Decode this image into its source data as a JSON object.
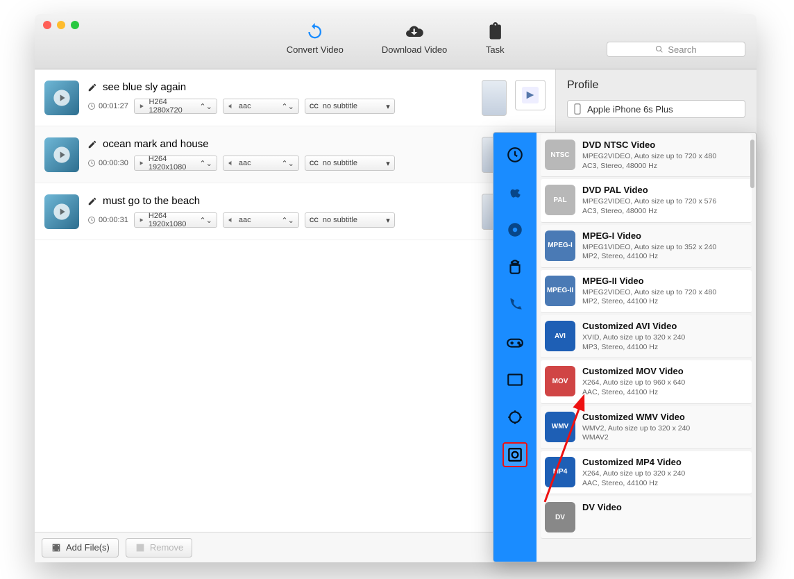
{
  "toolbar": {
    "convert": "Convert Video",
    "download": "Download Video",
    "task": "Task"
  },
  "search": {
    "placeholder": "Search"
  },
  "files": [
    {
      "title": "see blue sly again",
      "duration": "00:01:27",
      "format": "H264 1280x720",
      "audio": "aac",
      "subtitle": "no subtitle"
    },
    {
      "title": "ocean mark and house",
      "duration": "00:00:30",
      "format": "H264 1920x1080",
      "audio": "aac",
      "subtitle": "no subtitle"
    },
    {
      "title": "must go to the beach",
      "duration": "00:00:31",
      "format": "H264 1920x1080",
      "audio": "aac",
      "subtitle": "no subtitle"
    }
  ],
  "footer": {
    "add": "Add File(s)",
    "remove": "Remove"
  },
  "profile": {
    "heading": "Profile",
    "selected": "Apple iPhone 6s Plus"
  },
  "subtitle_prefix": "CC",
  "categories": [
    "recent",
    "apple",
    "disc",
    "android",
    "phone",
    "game",
    "video",
    "custom",
    "format"
  ],
  "profiles": [
    {
      "name": "DVD NTSC Video",
      "desc1": "MPEG2VIDEO, Auto size up to 720 x 480",
      "desc2": "AC3, Stereo, 48000 Hz",
      "badge": "NTSC",
      "bg": "#b8b8b8"
    },
    {
      "name": "DVD PAL Video",
      "desc1": "MPEG2VIDEO, Auto size up to 720 x 576",
      "desc2": "AC3, Stereo, 48000 Hz",
      "badge": "PAL",
      "bg": "#b8b8b8"
    },
    {
      "name": "MPEG-I Video",
      "desc1": "MPEG1VIDEO, Auto size up to 352 x 240",
      "desc2": "MP2, Stereo, 44100 Hz",
      "badge": "MPEG-I",
      "bg": "#4a7ab5"
    },
    {
      "name": "MPEG-II Video",
      "desc1": "MPEG2VIDEO, Auto size up to 720 x 480",
      "desc2": "MP2, Stereo, 44100 Hz",
      "badge": "MPEG-II",
      "bg": "#4a7ab5"
    },
    {
      "name": "Customized AVI Video",
      "desc1": "XVID, Auto size up to 320 x 240",
      "desc2": "MP3, Stereo, 44100 Hz",
      "badge": "AVI",
      "bg": "#1e5fb5"
    },
    {
      "name": "Customized MOV Video",
      "desc1": "X264, Auto size up to 960 x 640",
      "desc2": "AAC, Stereo, 44100 Hz",
      "badge": "MOV",
      "bg": "#d04545"
    },
    {
      "name": "Customized WMV Video",
      "desc1": "WMV2, Auto size up to 320 x 240",
      "desc2": "WMAV2",
      "badge": "WMV",
      "bg": "#1e5fb5"
    },
    {
      "name": "Customized MP4 Video",
      "desc1": "X264, Auto size up to 320 x 240",
      "desc2": "AAC, Stereo, 44100 Hz",
      "badge": "MP4",
      "bg": "#1e5fb5"
    },
    {
      "name": "DV Video",
      "desc1": "",
      "desc2": "",
      "badge": "DV",
      "bg": "#888"
    }
  ]
}
